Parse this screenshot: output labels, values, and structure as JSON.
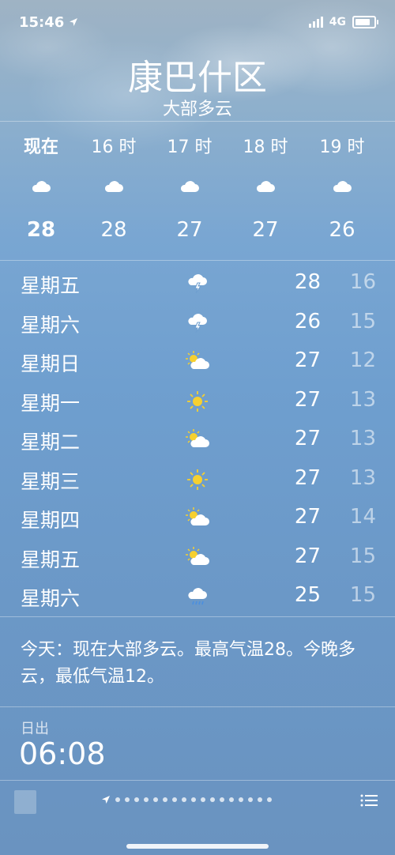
{
  "status": {
    "time": "15:46",
    "network": "4G"
  },
  "location": {
    "city": "康巴什区",
    "condition": "大部多云"
  },
  "hourly": [
    {
      "label": "现在",
      "temp": "28",
      "icon": "cloud-icon"
    },
    {
      "label": "16 时",
      "temp": "28",
      "icon": "cloud-icon"
    },
    {
      "label": "17 时",
      "temp": "27",
      "icon": "cloud-icon"
    },
    {
      "label": "18 时",
      "temp": "27",
      "icon": "cloud-icon"
    },
    {
      "label": "19 时",
      "temp": "26",
      "icon": "cloud-icon"
    }
  ],
  "daily": [
    {
      "day": "星期五",
      "icon": "thunderstorm-icon",
      "high": "28",
      "low": "16"
    },
    {
      "day": "星期六",
      "icon": "thunderstorm-icon",
      "high": "26",
      "low": "15"
    },
    {
      "day": "星期日",
      "icon": "partly-cloudy-icon",
      "high": "27",
      "low": "12"
    },
    {
      "day": "星期一",
      "icon": "sun-icon",
      "high": "27",
      "low": "13"
    },
    {
      "day": "星期二",
      "icon": "partly-cloudy-icon",
      "high": "27",
      "low": "13"
    },
    {
      "day": "星期三",
      "icon": "sun-icon",
      "high": "27",
      "low": "13"
    },
    {
      "day": "星期四",
      "icon": "partly-cloudy-icon",
      "high": "27",
      "low": "14"
    },
    {
      "day": "星期五",
      "icon": "partly-cloudy-icon",
      "high": "27",
      "low": "15"
    },
    {
      "day": "星期六",
      "icon": "rain-icon",
      "high": "25",
      "low": "15"
    }
  ],
  "summary": "今天：现在大部多云。最高气温28。今晚多云，最低气温12。",
  "sunrise": {
    "label": "日出",
    "value": "06:08"
  },
  "footer": {
    "page_dots": 17
  }
}
